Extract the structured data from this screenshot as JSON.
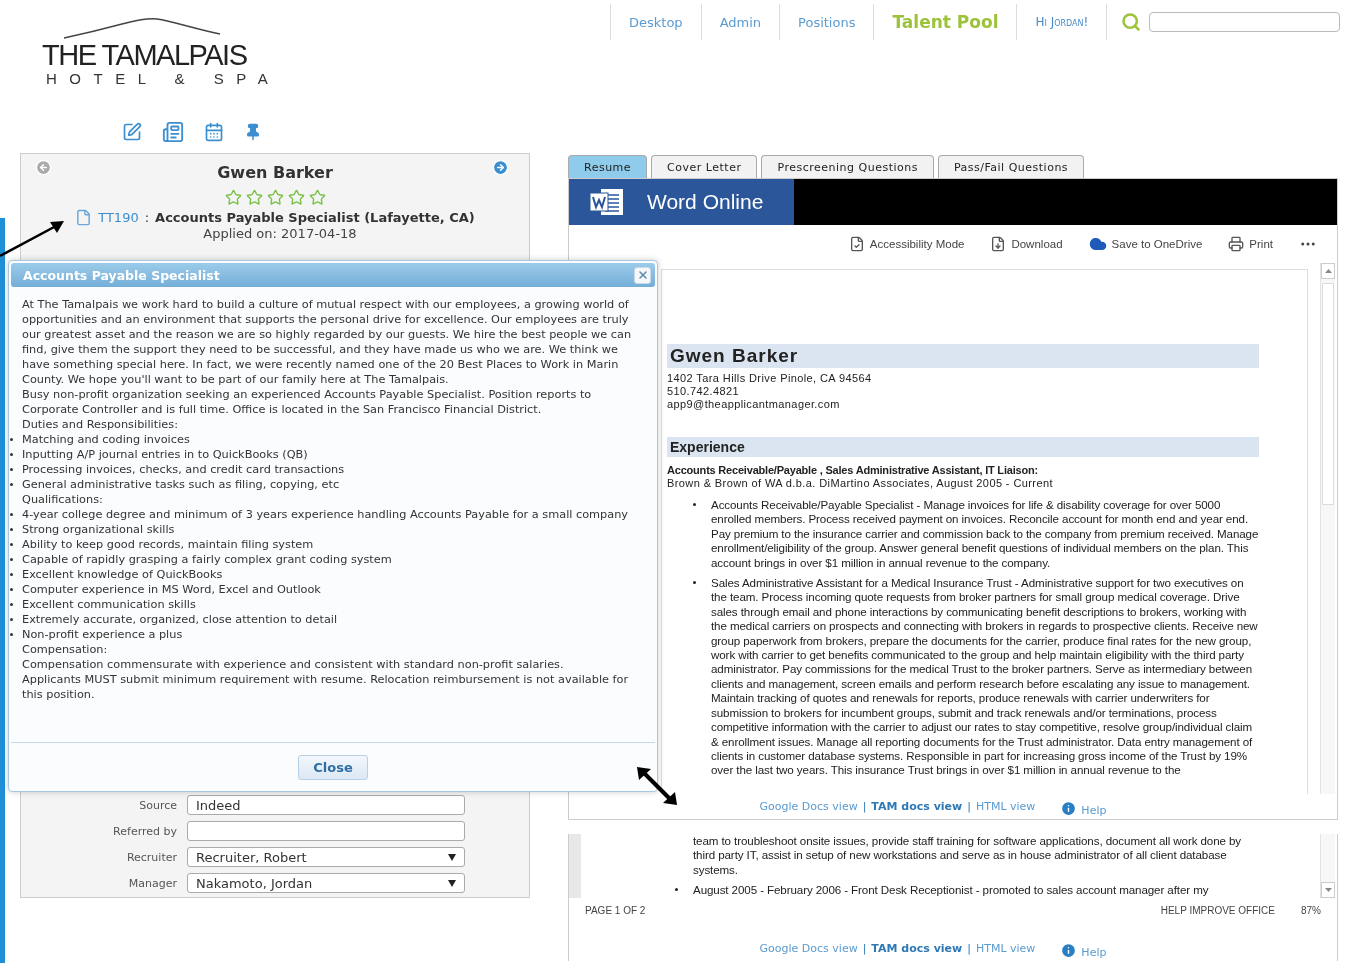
{
  "logo": {
    "title": "THE TAMALPAIS",
    "subtitle": "HOTEL & SPA"
  },
  "nav": [
    {
      "label": "Desktop",
      "selected": false
    },
    {
      "label": "Admin",
      "selected": false
    },
    {
      "label": "Positions",
      "selected": false
    },
    {
      "label": "Talent Pool",
      "selected": true
    }
  ],
  "greeting": "Hi Jordan!",
  "candidate": {
    "name": "Gwen Barker",
    "stars": 0,
    "job_code": "TT190",
    "separator": ":",
    "job_title": "Accounts Payable Specialist (Lafayette, CA)",
    "applied": "Applied on: 2017-04-18",
    "fields": [
      {
        "label": "Source",
        "value": "Indeed",
        "kind": "text"
      },
      {
        "label": "Referred by",
        "kind": "text"
      },
      {
        "label": "Recruiter",
        "value": "Recruiter, Robert",
        "kind": "select"
      },
      {
        "label": "Manager",
        "value": "Nakamoto, Jordan",
        "kind": "select"
      }
    ]
  },
  "dialog": {
    "title": "Accounts Payable Specialist",
    "close_button": "Close",
    "paragraphs": [
      {
        "kind": "text",
        "text": "At The Tamalpais we work hard to build a culture of mutual respect with our employees, a growing world of opportunities and an environment that supports the personal drive for excellence. Our employees are truly our greatest asset and the reason we are so highly regarded by our guests. We hire the best people we can find, give them the support they need to be successful, and they have made us who we are. We think we have something special here. In fact, we were recently named one of the 20 Best Places to Work in Marin County. We hope you'll want to be part of our family here at The Tamalpais."
      },
      {
        "kind": "text",
        "text": "Busy non-profit organization seeking an experienced Accounts Payable Specialist. Position reports to Corporate Controller and is full time. Office is located in the San Francisco Financial District."
      },
      {
        "kind": "text",
        "text": "Duties and Responsibilities:"
      },
      {
        "kind": "bullet",
        "text": "Matching and coding invoices"
      },
      {
        "kind": "bullet",
        "text": "Inputting A/P journal entries in to QuickBooks (QB)"
      },
      {
        "kind": "bullet",
        "text": "Processing invoices, checks, and credit card transactions"
      },
      {
        "kind": "bullet",
        "text": "General administrative tasks such as filing, copying, etc"
      },
      {
        "kind": "text",
        "text": "Qualifications:"
      },
      {
        "kind": "bullet",
        "text": "4-year college degree and minimum of 3 years experience handling Accounts Payable for a small company"
      },
      {
        "kind": "bullet",
        "text": "Strong organizational skills"
      },
      {
        "kind": "bullet",
        "text": "Ability to keep good records, maintain filing system"
      },
      {
        "kind": "bullet",
        "text": "Capable of rapidly grasping a fairly complex grant coding system"
      },
      {
        "kind": "bullet",
        "text": "Excellent knowledge of QuickBooks"
      },
      {
        "kind": "bullet",
        "text": "Computer experience in MS Word, Excel and Outlook"
      },
      {
        "kind": "bullet",
        "text": "Excellent communication skills"
      },
      {
        "kind": "bullet",
        "text": "Extremely accurate, organized, close attention to detail"
      },
      {
        "kind": "bullet",
        "text": "Non-profit experience a plus"
      },
      {
        "kind": "text",
        "text": "Compensation:"
      },
      {
        "kind": "text",
        "text": "Compensation commensurate with experience and consistent with standard non-profit salaries."
      },
      {
        "kind": "text",
        "text": "Applicants MUST submit minimum requirement with resume. Relocation reimbursement is not available for this position."
      }
    ]
  },
  "tabs": [
    {
      "label": "Resume",
      "selected": true
    },
    {
      "label": "Cover Letter",
      "selected": false
    },
    {
      "label": "Prescreening Questions",
      "selected": false
    },
    {
      "label": "Pass/Fail Questions",
      "selected": false
    }
  ],
  "viewer": {
    "app_name": "Word Online",
    "toolbar": [
      {
        "label": "Accessibility Mode",
        "kind": "accessibility"
      },
      {
        "label": "Download",
        "kind": "download"
      },
      {
        "label": "Save to OneDrive",
        "kind": "cloud"
      },
      {
        "label": "Print",
        "kind": "print"
      }
    ]
  },
  "document": {
    "name": "Gwen Barker",
    "address": "1402  Tara Hills  Drive  Pinole,  CA  94564",
    "phone": "510.742.4821",
    "email": "app9@theapplicantmanager.com",
    "section": "Experience",
    "role": "Accounts Receivable/Payable , Sales Administrative Assistant, IT Liaison:",
    "employer": "Brown & Brown of WA d.b.a. DiMartino Associates, August 2005 - Current",
    "bullets": [
      "Accounts Receivable/Payable Specialist - Manage invoices for life & disability coverage for over 5000 enrolled members. Process received payment on invoices.  Reconcile account for month end and year end.  Pay premium to the insurance carrier and commission back to the company from premium received. Manage enrollment/eligibility of the group.  Answer general benefit questions of individual members on the plan.  This account brings in over $1 million in annual revenue to the company.",
      "Sales Administrative Assistant for a Medical Insurance Trust - Administrative support for two executives on the team.  Process incoming quote requests from broker partners for small group medical coverage. Drive sales through email and phone interactions by communicating benefit descriptions to brokers, working with the medical carriers on prospects and connecting with brokers in regards to prospective clients. Receive new group paperwork from brokers, prepare the documents for the carrier, produce final rates for the new group, work with carrier to get benefits communicated to the group and help maintain eligibility with the third party administrator. Pay commissions for the medical Trust to the broker partners.  Serve as intermediary between clients and management, screen emails and perform research before escalating any issue to management. Maintain tracking of quotes and renewals for reports, produce renewals with carrier underwriters for submission to brokers for incumbent groups, submit and track renewals and/or terminations, process competitive information with the carrier to adjust our rates to stay competitive, resolve group/individual claim & enrollment issues. Manage all reporting documents for the Trust administrator. Data entry management of clients in customer database systems. Responsible in part for increasing gross income of the Trust by 19% over the last two years.  This insurance Trust brings in over $1 million in annual revenue to the"
    ]
  },
  "view_links": [
    {
      "label": "Google Docs view",
      "selected": false
    },
    {
      "label": "TAM docs view",
      "selected": true
    },
    {
      "label": "HTML view",
      "selected": false
    }
  ],
  "view_separator": "|",
  "help": "Help",
  "lower_viewer": {
    "continuation": "team to troubleshoot onsite issues, provide staff training for software applications, document all work done by third party IT, assist in setup of new workstations and  serve as in house administrator of all client database systems.",
    "bullets": [
      "August 2005  - February 2006 - Front Desk Receptionist - promoted to sales account manager after my"
    ],
    "status": {
      "page": "PAGE 1 OF 2",
      "feedback": "HELP IMPROVE OFFICE",
      "zoom": "87%"
    },
    "view_links": [
      {
        "label": "Google Docs view",
        "selected": false
      },
      {
        "label": "TAM docs view",
        "selected": true
      },
      {
        "label": "HTML view",
        "selected": false
      }
    ],
    "view_separator": "|",
    "help": "Help"
  }
}
